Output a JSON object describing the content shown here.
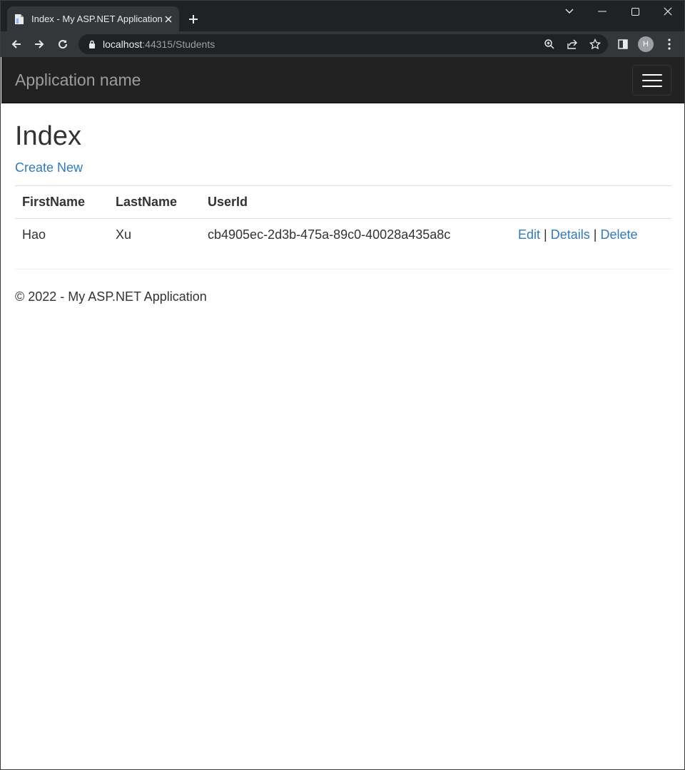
{
  "browser": {
    "tab_title": "Index - My ASP.NET Application",
    "url_host": "localhost",
    "url_path": ":44315/Students",
    "profile_initial": "H"
  },
  "navbar": {
    "brand": "Application name"
  },
  "page": {
    "title": "Index",
    "create_link": "Create New",
    "columns": [
      "FirstName",
      "LastName",
      "UserId"
    ],
    "rows": [
      {
        "first_name": "Hao",
        "last_name": "Xu",
        "user_id": "cb4905ec-2d3b-475a-89c0-40028a435a8c",
        "edit": "Edit",
        "details": "Details",
        "delete": "Delete",
        "sep": "|"
      }
    ],
    "footer": "© 2022 - My ASP.NET Application"
  },
  "colors": {
    "link": "#337ab7",
    "navbar_bg": "#222222",
    "brand": "#9d9d9d"
  }
}
